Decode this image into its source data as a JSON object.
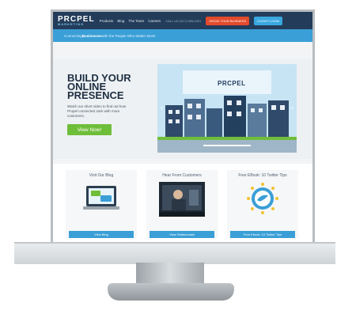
{
  "header": {
    "logo": "PRCPEL",
    "logo_sub": "MARKETING",
    "nav": [
      "Products",
      "Blog",
      "The Team",
      "Careers"
    ],
    "phone": "CALL US (917) 555-4321",
    "grow_button": "GROW YOUR BUSINESS",
    "login_button": "CLIENT LOGIN"
  },
  "tagline": {
    "pre": "Connecting ",
    "bold": "Businesses",
    "post": " with the People Who Matter Most!"
  },
  "hero": {
    "title_lines": [
      "BUILD YOUR",
      "ONLINE",
      "PRESENCE"
    ],
    "subtitle": "Watch our short video to find out how Propel connected Jack with more customers.",
    "cta": "View Now!"
  },
  "video": {
    "logo": "PRCPEL"
  },
  "cards": [
    {
      "title": "Visit Our Blog",
      "button": "View Blog"
    },
    {
      "title": "Hear From Customers",
      "button": "View Testimonials"
    },
    {
      "title": "Free EBook: 10 Twitter Tips",
      "button": "Free Ebook: 10 Twitter Tips"
    }
  ],
  "colors": {
    "header": "#233c5a",
    "tagline_bar": "#3a9fd6",
    "cta_green": "#6fbe3a",
    "grow_orange": "#e44a2c"
  }
}
